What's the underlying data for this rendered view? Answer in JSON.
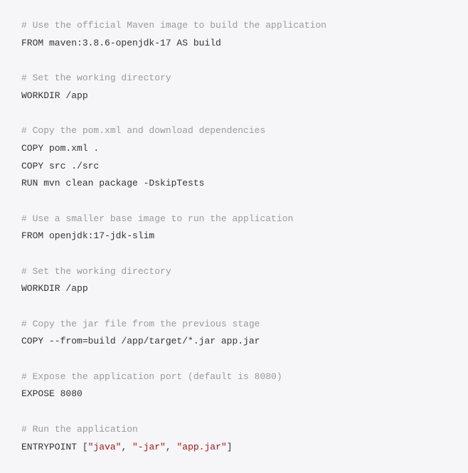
{
  "lines": [
    {
      "type": "comment",
      "text": "# Use the official Maven image to build the application"
    },
    {
      "type": "code",
      "text": "FROM maven:3.8.6-openjdk-17 AS build"
    },
    {
      "type": "blank",
      "text": ""
    },
    {
      "type": "comment",
      "text": "# Set the working directory"
    },
    {
      "type": "code",
      "text": "WORKDIR /app"
    },
    {
      "type": "blank",
      "text": ""
    },
    {
      "type": "comment",
      "text": "# Copy the pom.xml and download dependencies"
    },
    {
      "type": "code",
      "text": "COPY pom.xml ."
    },
    {
      "type": "code",
      "text": "COPY src ./src"
    },
    {
      "type": "code",
      "text": "RUN mvn clean package -DskipTests"
    },
    {
      "type": "blank",
      "text": ""
    },
    {
      "type": "comment",
      "text": "# Use a smaller base image to run the application"
    },
    {
      "type": "code",
      "text": "FROM openjdk:17-jdk-slim"
    },
    {
      "type": "blank",
      "text": ""
    },
    {
      "type": "comment",
      "text": "# Set the working directory"
    },
    {
      "type": "code",
      "text": "WORKDIR /app"
    },
    {
      "type": "blank",
      "text": ""
    },
    {
      "type": "comment",
      "text": "# Copy the jar file from the previous stage"
    },
    {
      "type": "code",
      "text": "COPY --from=build /app/target/*.jar app.jar"
    },
    {
      "type": "blank",
      "text": ""
    },
    {
      "type": "comment",
      "text": "# Expose the application port (default is 8080)"
    },
    {
      "type": "code",
      "text": "EXPOSE 8080"
    },
    {
      "type": "blank",
      "text": ""
    },
    {
      "type": "comment",
      "text": "# Run the application"
    },
    {
      "type": "entrypoint",
      "prefix": "ENTRYPOINT [",
      "s1": "\"java\"",
      "c1": ", ",
      "s2": "\"-jar\"",
      "c2": ", ",
      "s3": "\"app.jar\"",
      "suffix": "]"
    }
  ]
}
